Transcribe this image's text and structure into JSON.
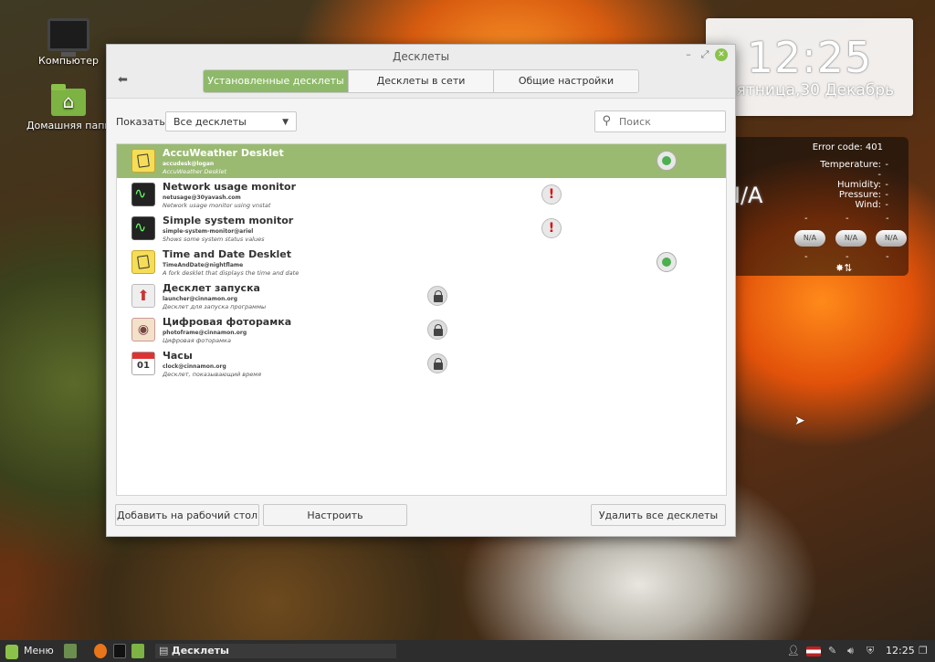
{
  "desktop": {
    "icons": [
      {
        "label": "Компьютер"
      },
      {
        "label": "Домашняя папк"
      }
    ]
  },
  "clock_desklet": {
    "time": "12:25",
    "date": "Пятница,30 Декабрь"
  },
  "weather_desklet": {
    "error": "Error code: 401",
    "labels": [
      "Temperature:",
      "Humidity:",
      "Pressure:",
      "Wind:"
    ],
    "dash": "-",
    "current": "N/A",
    "forecast": [
      "N/A",
      "N/A",
      "N/A"
    ]
  },
  "window": {
    "title": "Десклеты",
    "tabs": [
      {
        "label": "Установленные десклеты",
        "active": true
      },
      {
        "label": "Десклеты в сети",
        "active": false
      },
      {
        "label": "Общие настройки",
        "active": false
      }
    ],
    "show_label": "Показать",
    "filter_value": "Все десклеты",
    "search_placeholder": "Поиск",
    "desklets": [
      {
        "name": "AccuWeather Desklet",
        "uuid": "accudesk@logan",
        "desc": "AccuWeather Desklet",
        "icon": "note-icon",
        "status": "active",
        "selected": true
      },
      {
        "name": "Network usage monitor",
        "uuid": "netusage@30yavash.com",
        "desc": "Network usage monitor using vnstat",
        "icon": "monitor-icon",
        "status": "error",
        "selected": false
      },
      {
        "name": "Simple system monitor",
        "uuid": "simple-system-monitor@ariel",
        "desc": "Shows some system status values",
        "icon": "monitor-icon",
        "status": "error",
        "selected": false
      },
      {
        "name": "Time and Date Desklet",
        "uuid": "TimeAndDate@nightflame",
        "desc": "A fork desklet that displays the time and date",
        "icon": "note-icon",
        "status": "active",
        "selected": false
      },
      {
        "name": "Десклет запуска",
        "uuid": "launcher@cinnamon.org",
        "desc": "Десклет для запуска программы",
        "icon": "rocket-icon",
        "status": "locked",
        "selected": false
      },
      {
        "name": "Цифровая фоторамка",
        "uuid": "photoframe@cinnamon.org",
        "desc": "Цифровая фоторамка",
        "icon": "eye-icon",
        "status": "locked",
        "selected": false
      },
      {
        "name": "Часы",
        "uuid": "clock@cinnamon.org",
        "desc": "Десклет, показывающий время",
        "icon": "calendar-icon",
        "status": "locked",
        "selected": false,
        "icon_text": "01"
      }
    ],
    "buttons": {
      "add": "Добавить на рабочий стол",
      "configure": "Настроить",
      "remove_all": "Удалить все десклеты"
    }
  },
  "panel": {
    "menu_label": "Меню",
    "task_label": "Десклеты",
    "clock": "12:25"
  },
  "colors": {
    "accent": "#8fb96a",
    "selected_row": "#9aba72",
    "active_status": "#4caf50",
    "error_status": "#d00000"
  }
}
